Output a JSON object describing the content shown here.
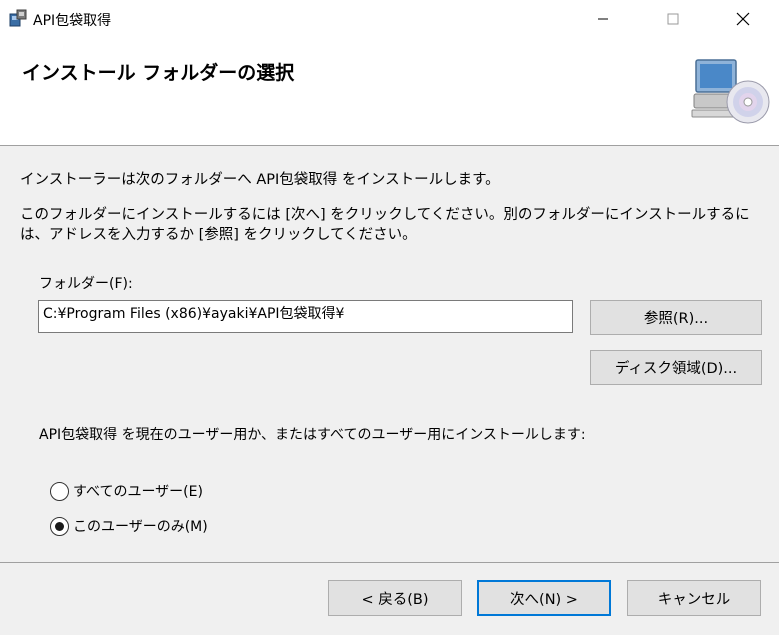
{
  "window": {
    "title": "API包袋取得",
    "icon": "installer-icon",
    "minimize_icon": "minimize-icon",
    "maximize_icon": "maximize-icon",
    "close_icon": "close-icon"
  },
  "header": {
    "title": "インストール フォルダーの選択",
    "graphic": "computer-disc-icon"
  },
  "body": {
    "intro": "インストーラーは次のフォルダーへ API包袋取得 をインストールします。",
    "description": "このフォルダーにインストールするには [次へ] をクリックしてください。別のフォルダーにインストールするには、アドレスを入力するか [参照] をクリックしてください。",
    "folder_label": "フォルダー(F):",
    "folder_value": "C:¥Program Files (x86)¥ayaki¥API包袋取得¥",
    "browse_button": "参照(R)...",
    "disk_button": "ディスク領域(D)...",
    "install_for": "API包袋取得 を現在のユーザー用か、またはすべてのユーザー用にインストールします:",
    "radio_all": "すべてのユーザー(E)",
    "radio_me": "このユーザーのみ(M)",
    "selected_option": "このユーザーのみ(M)"
  },
  "footer": {
    "back_button": "< 戻る(B)",
    "next_button": "次へ(N) >",
    "cancel_button": "キャンセル"
  },
  "colors": {
    "accent": "#0078d7",
    "background": "#f0f0f0",
    "header_background": "#ffffff"
  }
}
